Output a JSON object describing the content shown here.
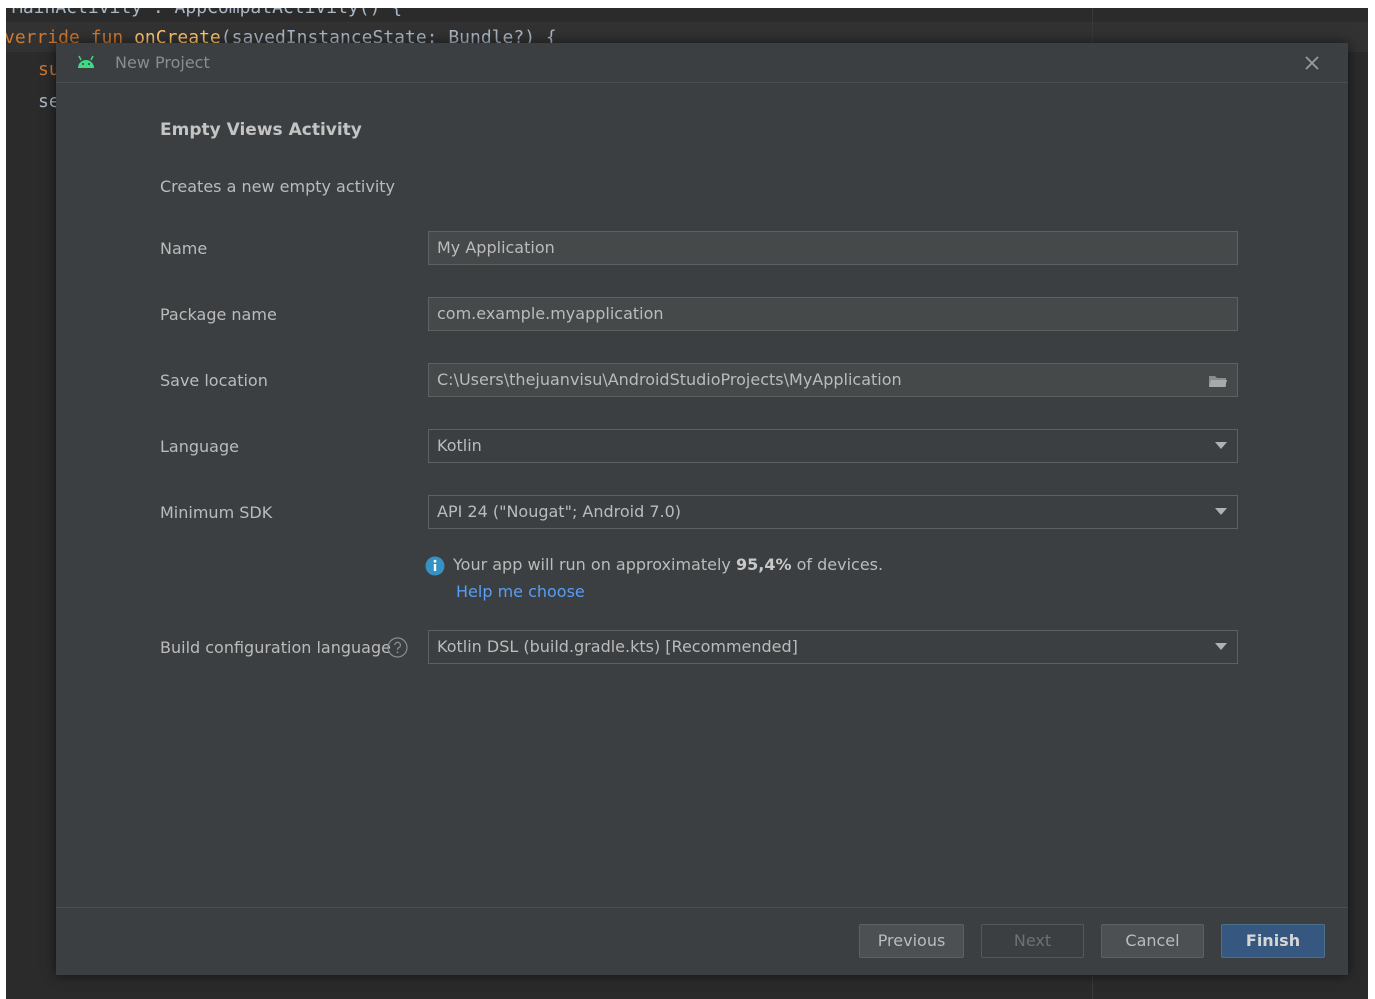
{
  "editor": {
    "line0": "MainActivity : AppCompatActivity() {",
    "line1": {
      "kw1": "verride",
      "kw2": "fun",
      "fn": "onCreate",
      "rest": "(savedInstanceState: Bundle?) {"
    },
    "line2": "su",
    "line3": "se"
  },
  "dialog": {
    "title": "New Project",
    "heading": "Empty Views Activity",
    "description": "Creates a new empty activity",
    "fields": {
      "name": {
        "label": "Name",
        "value": "My Application"
      },
      "package": {
        "label": "Package name",
        "value": "com.example.myapplication"
      },
      "save_location": {
        "label": "Save location",
        "value": "C:\\Users\\thejuanvisu\\AndroidStudioProjects\\MyApplication"
      },
      "language": {
        "label": "Language",
        "value": "Kotlin"
      },
      "min_sdk": {
        "label": "Minimum SDK",
        "value": "API 24 (\"Nougat\"; Android 7.0)"
      },
      "build_config": {
        "label": "Build configuration language",
        "value": "Kotlin DSL (build.gradle.kts) [Recommended]"
      }
    },
    "info": {
      "prefix": "Your app will run on approximately",
      "percent": "95,4%",
      "suffix": "of devices.",
      "link": "Help me choose"
    },
    "buttons": {
      "previous": "Previous",
      "next": "Next",
      "cancel": "Cancel",
      "finish": "Finish"
    }
  },
  "icons": {
    "app": "android-icon",
    "close": "close-icon",
    "folder": "folder-icon",
    "dropdown": "chevron-down-icon",
    "info": "info-icon",
    "help": "question-icon"
  },
  "colors": {
    "dialog_bg": "#3c3f41",
    "editor_bg": "#2b2b2b",
    "link": "#589df6",
    "primary_button": "#365880",
    "android_green": "#3ddc84"
  }
}
